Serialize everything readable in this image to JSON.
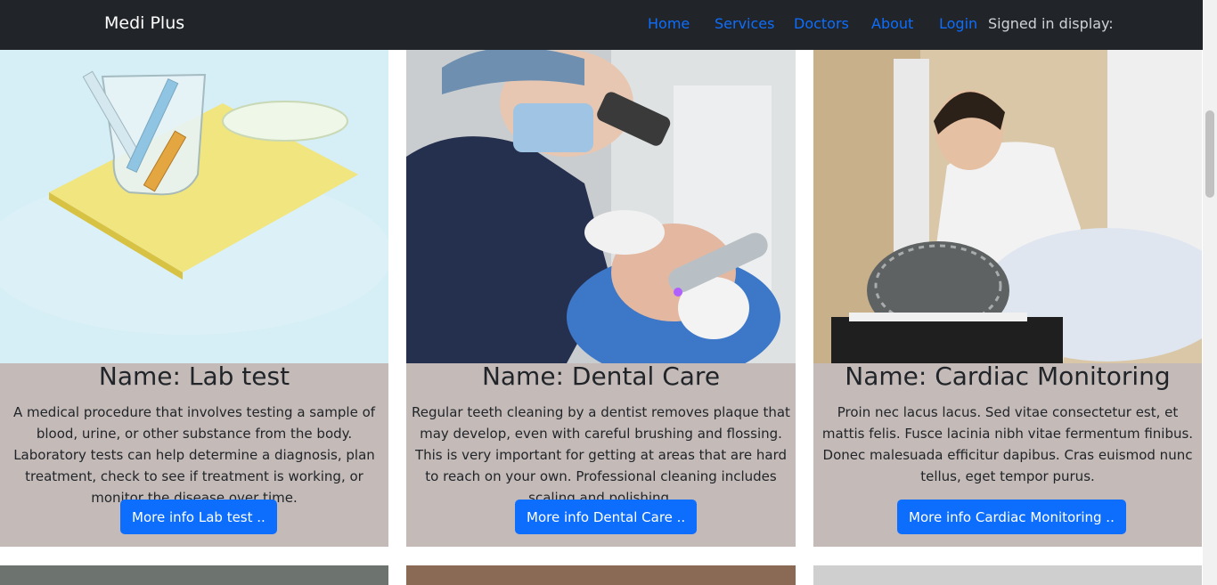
{
  "navbar": {
    "brand": "Medi Plus",
    "links": [
      "Home",
      "Services",
      "Doctors",
      "About",
      "Login"
    ],
    "signed_in_text": "Signed in display:"
  },
  "cards": [
    {
      "title": "Name: Lab test",
      "description": "A medical procedure that involves testing a sample of blood, urine, or other substance from the body. Laboratory tests can help determine a diagnosis, plan treatment, check to see if treatment is working, or monitor the disease over time.",
      "button": "More info Lab test .."
    },
    {
      "title": "Name: Dental Care",
      "description": "Regular teeth cleaning by a dentist removes plaque that may develop, even with careful brushing and flossing. This is very important for getting at areas that are hard to reach on your own. Professional cleaning includes scaling and polishing.",
      "button": "More info Dental Care .."
    },
    {
      "title": "Name: Cardiac Monitoring",
      "description": "Proin nec lacus lacus. Sed vitae consectetur est, et mattis felis. Fusce lacinia nibh vitae fermentum finibus. Donec malesuada efficitur dapibus. Cras euismod nunc tellus, eget tempor purus.",
      "button": "More info Cardiac Monitoring .."
    }
  ],
  "colors": {
    "navbar_bg": "#212529",
    "link": "#0d6efd",
    "card_bg": "#c4bbb9",
    "button_bg": "#0d6efd"
  }
}
